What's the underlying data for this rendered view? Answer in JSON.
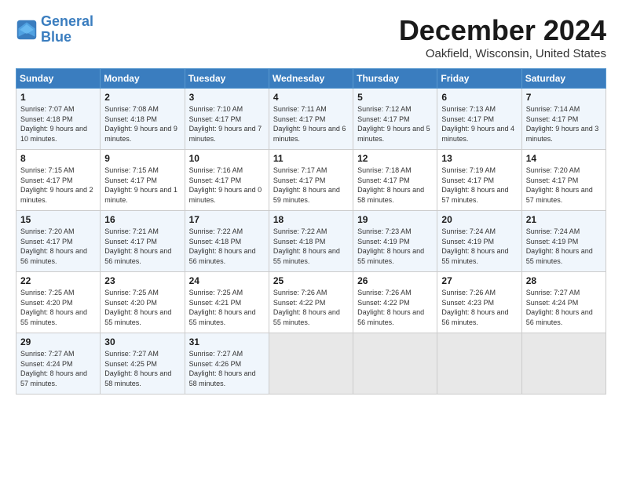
{
  "logo": {
    "line1": "General",
    "line2": "Blue"
  },
  "title": "December 2024",
  "location": "Oakfield, Wisconsin, United States",
  "days_header": [
    "Sunday",
    "Monday",
    "Tuesday",
    "Wednesday",
    "Thursday",
    "Friday",
    "Saturday"
  ],
  "weeks": [
    [
      {
        "day": "1",
        "rise": "7:07 AM",
        "set": "4:18 PM",
        "daylight": "9 hours and 10 minutes."
      },
      {
        "day": "2",
        "rise": "7:08 AM",
        "set": "4:18 PM",
        "daylight": "9 hours and 9 minutes."
      },
      {
        "day": "3",
        "rise": "7:10 AM",
        "set": "4:17 PM",
        "daylight": "9 hours and 7 minutes."
      },
      {
        "day": "4",
        "rise": "7:11 AM",
        "set": "4:17 PM",
        "daylight": "9 hours and 6 minutes."
      },
      {
        "day": "5",
        "rise": "7:12 AM",
        "set": "4:17 PM",
        "daylight": "9 hours and 5 minutes."
      },
      {
        "day": "6",
        "rise": "7:13 AM",
        "set": "4:17 PM",
        "daylight": "9 hours and 4 minutes."
      },
      {
        "day": "7",
        "rise": "7:14 AM",
        "set": "4:17 PM",
        "daylight": "9 hours and 3 minutes."
      }
    ],
    [
      {
        "day": "8",
        "rise": "7:15 AM",
        "set": "4:17 PM",
        "daylight": "9 hours and 2 minutes."
      },
      {
        "day": "9",
        "rise": "7:15 AM",
        "set": "4:17 PM",
        "daylight": "9 hours and 1 minute."
      },
      {
        "day": "10",
        "rise": "7:16 AM",
        "set": "4:17 PM",
        "daylight": "9 hours and 0 minutes."
      },
      {
        "day": "11",
        "rise": "7:17 AM",
        "set": "4:17 PM",
        "daylight": "8 hours and 59 minutes."
      },
      {
        "day": "12",
        "rise": "7:18 AM",
        "set": "4:17 PM",
        "daylight": "8 hours and 58 minutes."
      },
      {
        "day": "13",
        "rise": "7:19 AM",
        "set": "4:17 PM",
        "daylight": "8 hours and 57 minutes."
      },
      {
        "day": "14",
        "rise": "7:20 AM",
        "set": "4:17 PM",
        "daylight": "8 hours and 57 minutes."
      }
    ],
    [
      {
        "day": "15",
        "rise": "7:20 AM",
        "set": "4:17 PM",
        "daylight": "8 hours and 56 minutes."
      },
      {
        "day": "16",
        "rise": "7:21 AM",
        "set": "4:17 PM",
        "daylight": "8 hours and 56 minutes."
      },
      {
        "day": "17",
        "rise": "7:22 AM",
        "set": "4:18 PM",
        "daylight": "8 hours and 56 minutes."
      },
      {
        "day": "18",
        "rise": "7:22 AM",
        "set": "4:18 PM",
        "daylight": "8 hours and 55 minutes."
      },
      {
        "day": "19",
        "rise": "7:23 AM",
        "set": "4:19 PM",
        "daylight": "8 hours and 55 minutes."
      },
      {
        "day": "20",
        "rise": "7:24 AM",
        "set": "4:19 PM",
        "daylight": "8 hours and 55 minutes."
      },
      {
        "day": "21",
        "rise": "7:24 AM",
        "set": "4:19 PM",
        "daylight": "8 hours and 55 minutes."
      }
    ],
    [
      {
        "day": "22",
        "rise": "7:25 AM",
        "set": "4:20 PM",
        "daylight": "8 hours and 55 minutes."
      },
      {
        "day": "23",
        "rise": "7:25 AM",
        "set": "4:20 PM",
        "daylight": "8 hours and 55 minutes."
      },
      {
        "day": "24",
        "rise": "7:25 AM",
        "set": "4:21 PM",
        "daylight": "8 hours and 55 minutes."
      },
      {
        "day": "25",
        "rise": "7:26 AM",
        "set": "4:22 PM",
        "daylight": "8 hours and 55 minutes."
      },
      {
        "day": "26",
        "rise": "7:26 AM",
        "set": "4:22 PM",
        "daylight": "8 hours and 56 minutes."
      },
      {
        "day": "27",
        "rise": "7:26 AM",
        "set": "4:23 PM",
        "daylight": "8 hours and 56 minutes."
      },
      {
        "day": "28",
        "rise": "7:27 AM",
        "set": "4:24 PM",
        "daylight": "8 hours and 56 minutes."
      }
    ],
    [
      {
        "day": "29",
        "rise": "7:27 AM",
        "set": "4:24 PM",
        "daylight": "8 hours and 57 minutes."
      },
      {
        "day": "30",
        "rise": "7:27 AM",
        "set": "4:25 PM",
        "daylight": "8 hours and 58 minutes."
      },
      {
        "day": "31",
        "rise": "7:27 AM",
        "set": "4:26 PM",
        "daylight": "8 hours and 58 minutes."
      },
      null,
      null,
      null,
      null
    ]
  ]
}
